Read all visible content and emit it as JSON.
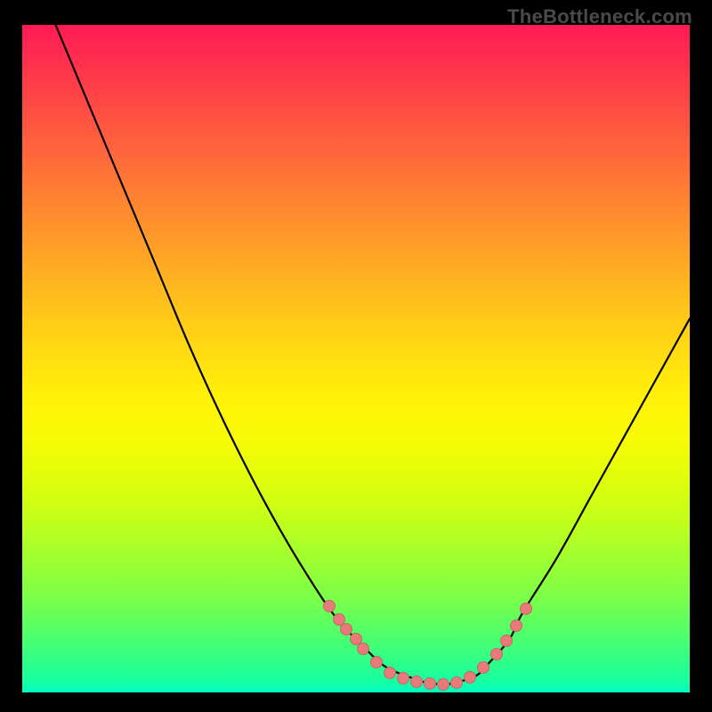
{
  "watermark": "TheBottleneck.com",
  "colors": {
    "background": "#000000",
    "gradient_top": "#ff1a55",
    "gradient_bottom": "#00ffc0",
    "curve": "#000000",
    "points": "#e87a7a"
  },
  "chart_data": {
    "type": "line",
    "title": "",
    "xlabel": "",
    "ylabel": "",
    "xlim": [
      0,
      100
    ],
    "ylim": [
      0,
      100
    ],
    "curve": {
      "x": [
        5,
        10,
        15,
        20,
        25,
        30,
        35,
        40,
        45,
        48,
        50,
        53,
        55,
        58,
        60,
        63,
        65,
        68,
        70,
        73,
        75,
        80,
        85,
        90,
        95,
        100
      ],
      "y": [
        100,
        88,
        76,
        64,
        52,
        41,
        31,
        22,
        14,
        10,
        8,
        5,
        3.5,
        2.3,
        1.6,
        1.2,
        1.5,
        2.5,
        4.5,
        8,
        12,
        20,
        29,
        38,
        47,
        56
      ]
    },
    "points": [
      {
        "x": 46,
        "y": 13
      },
      {
        "x": 47.5,
        "y": 11
      },
      {
        "x": 48.5,
        "y": 9.5
      },
      {
        "x": 50,
        "y": 8
      },
      {
        "x": 51,
        "y": 6.5
      },
      {
        "x": 53,
        "y": 4.5
      },
      {
        "x": 55,
        "y": 3
      },
      {
        "x": 57,
        "y": 2.2
      },
      {
        "x": 59,
        "y": 1.6
      },
      {
        "x": 61,
        "y": 1.3
      },
      {
        "x": 63,
        "y": 1.2
      },
      {
        "x": 65,
        "y": 1.5
      },
      {
        "x": 67,
        "y": 2.3
      },
      {
        "x": 69,
        "y": 3.8
      },
      {
        "x": 71,
        "y": 5.8
      },
      {
        "x": 72.5,
        "y": 7.8
      },
      {
        "x": 74,
        "y": 10
      },
      {
        "x": 75.5,
        "y": 12.5
      }
    ]
  }
}
